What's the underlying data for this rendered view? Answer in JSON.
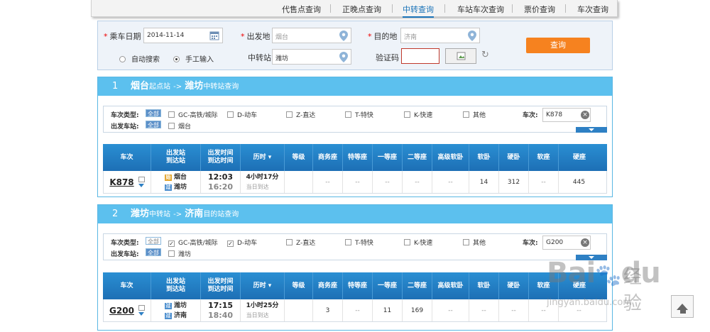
{
  "topnav": {
    "items": [
      "代售点查询",
      "正晚点查询",
      "中转查询",
      "车站车次查询",
      "票价查询",
      "车次查询"
    ],
    "active_index": 2
  },
  "search": {
    "date_label": "乘车日期",
    "date_value": "2014-11-14",
    "from_label": "出发地",
    "from_value": "烟台",
    "to_label": "目的地",
    "to_value": "济南",
    "mode_auto": "自动搜索",
    "mode_manual": "手工输入",
    "transfer_label": "中转站",
    "transfer_value": "潍坊",
    "captcha_label": "验证码",
    "captcha_value": "",
    "query_button": "查询",
    "required_mark": "*"
  },
  "colors": {
    "accent": "#5cc0ee",
    "header_blue": "#1d6fb5",
    "query_orange": "#f6821f",
    "required": "#e00000"
  },
  "filter_labels": {
    "train_type": "车次类型:",
    "dep_station": "出发车站:",
    "all": "全部",
    "train_no": "车次:",
    "types": [
      "GC-高铁/城际",
      "D-动车",
      "Z-直达",
      "T-特快",
      "K-快速",
      "其他"
    ]
  },
  "table_headers": {
    "train": "车次",
    "station": [
      "出发站",
      "到达站"
    ],
    "time": [
      "出发时间",
      "到达时间"
    ],
    "duration": "历时",
    "cols": [
      "等级",
      "商务座",
      "特等座",
      "一等座",
      "二等座",
      "高级软卧",
      "软卧",
      "硬卧",
      "软座",
      "硬座"
    ]
  },
  "segments": [
    {
      "num": "1",
      "from": "烟台",
      "from_role": "起点站",
      "arrow": "->",
      "to": "潍坊",
      "to_role": "中转站查询",
      "train_input": "K878",
      "dep_station_option": "烟台",
      "type_checked": [
        false,
        false,
        false,
        false,
        false,
        false
      ],
      "row": {
        "train_no": "K878",
        "from_station": "烟台",
        "from_tag": "始",
        "to_station": "潍坊",
        "to_tag": "过",
        "dep_time": "12:03",
        "arr_time": "16:20",
        "duration": "4小时17分",
        "arrival_day": "当日到达",
        "cells": [
          "",
          "--",
          "--",
          "--",
          "--",
          "--",
          "14",
          "312",
          "--",
          "445"
        ]
      }
    },
    {
      "num": "2",
      "from": "潍坊",
      "from_role": "中转站",
      "arrow": "->",
      "to": "济南",
      "to_role": "目的站查询",
      "train_input": "G200",
      "dep_station_option": "潍坊",
      "type_checked": [
        true,
        true,
        false,
        false,
        false,
        false
      ],
      "row": {
        "train_no": "G200",
        "from_station": "潍坊",
        "from_tag": "过",
        "to_station": "济南",
        "to_tag": "过",
        "dep_time": "17:15",
        "arr_time": "18:40",
        "duration": "1小时25分",
        "arrival_day": "当日到达",
        "cells": [
          "",
          "3",
          "--",
          "11",
          "169",
          "--",
          "--",
          "--",
          "--",
          "--"
        ]
      }
    }
  ],
  "watermark": {
    "logo": "Bai",
    "logo_tail": "du",
    "cn": "经验",
    "url": "jingyan.baidu.com"
  }
}
